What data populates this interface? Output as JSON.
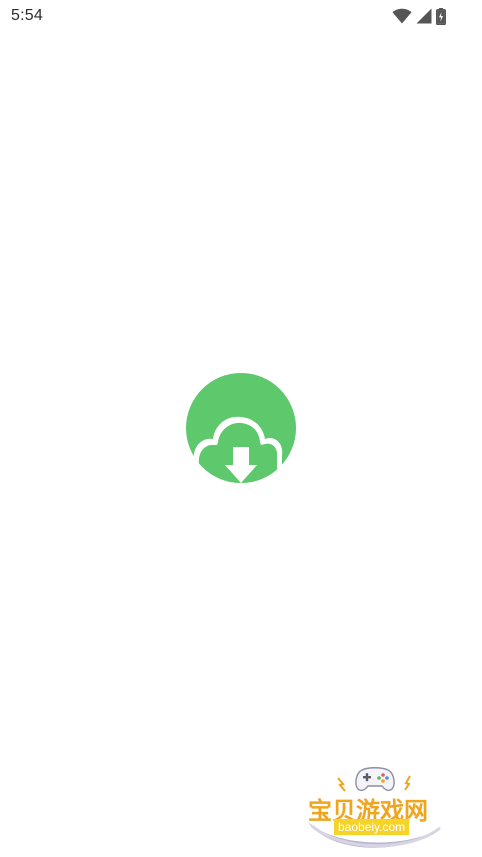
{
  "status_bar": {
    "time": "5:54",
    "icons": [
      "wifi-icon",
      "cellular-signal-icon",
      "battery-charging-icon"
    ]
  },
  "splash": {
    "logo_icon": "cloud-download-icon",
    "logo_color": "#5dc86c"
  },
  "watermark": {
    "title": "宝贝游戏网",
    "domain": "baobeiy.com",
    "title_color": "#f0a51e",
    "domain_bg_color": "#f5d327"
  }
}
